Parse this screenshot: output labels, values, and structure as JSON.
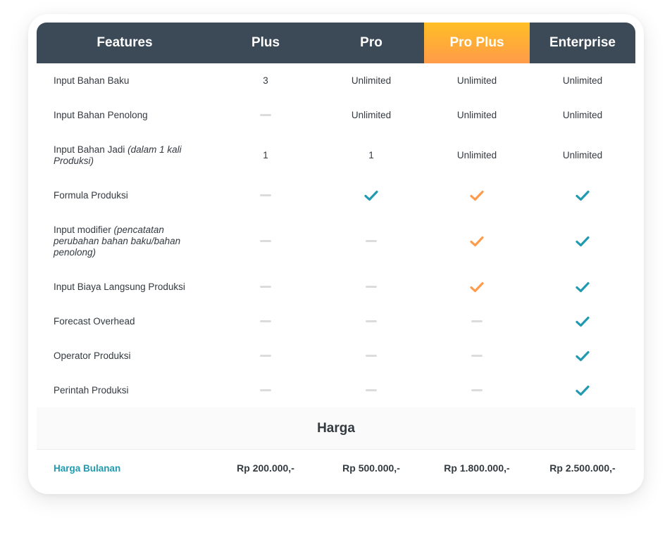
{
  "colors": {
    "header_bg": "#3c4a58",
    "highlight_gradient_top": "#ffbe25",
    "highlight_gradient_bottom": "#ff9b4a",
    "check_teal": "#1f9ab0",
    "check_orange": "#ff9b4a",
    "dash_gray": "#dcdcdc",
    "link_teal": "#1f9ab0"
  },
  "header": {
    "features": "Features",
    "plans": [
      "Plus",
      "Pro",
      "Pro Plus",
      "Enterprise"
    ],
    "highlighted_plan": "Pro Plus"
  },
  "rows": [
    {
      "label": "Input Bahan Baku",
      "note": "",
      "values": [
        "3",
        "Unlimited",
        "Unlimited",
        "Unlimited"
      ]
    },
    {
      "label": "Input Bahan Penolong",
      "note": "",
      "values": [
        "dash",
        "Unlimited",
        "Unlimited",
        "Unlimited"
      ]
    },
    {
      "label": "Input Bahan Jadi ",
      "note": "(dalam 1 kali Produksi)",
      "values": [
        "1",
        "1",
        "Unlimited",
        "Unlimited"
      ]
    },
    {
      "label": "Formula Produksi",
      "note": "",
      "values": [
        "dash",
        "check",
        "check",
        "check"
      ]
    },
    {
      "label": "Input modifier ",
      "note": "(pencatatan perubahan bahan baku/bahan penolong)",
      "values": [
        "dash",
        "dash",
        "check",
        "check"
      ]
    },
    {
      "label": "Input Biaya Langsung Produksi",
      "note": "",
      "values": [
        "dash",
        "dash",
        "check",
        "check"
      ]
    },
    {
      "label": "Forecast Overhead",
      "note": "",
      "values": [
        "dash",
        "dash",
        "dash",
        "check"
      ]
    },
    {
      "label": "Operator Produksi",
      "note": "",
      "values": [
        "dash",
        "dash",
        "dash",
        "check"
      ]
    },
    {
      "label": "Perintah Produksi",
      "note": "",
      "values": [
        "dash",
        "dash",
        "dash",
        "check"
      ]
    }
  ],
  "harga": {
    "title": "Harga",
    "label": "Harga Bulanan",
    "prices": [
      "Rp 200.000,-",
      "Rp 500.000,-",
      "Rp 1.800.000,-",
      "Rp 2.500.000,-"
    ]
  }
}
